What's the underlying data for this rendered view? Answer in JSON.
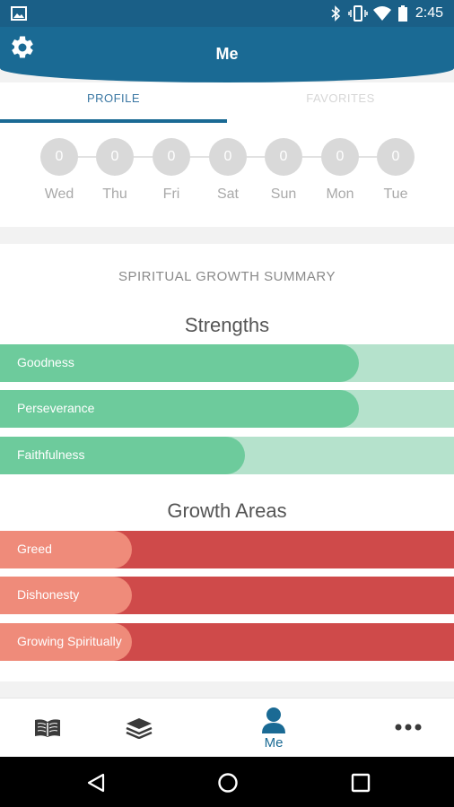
{
  "status_bar": {
    "time": "2:45"
  },
  "app_bar": {
    "title": "Me",
    "settings_icon": "gear-icon"
  },
  "tabs": [
    {
      "label": "PROFILE",
      "active": true
    },
    {
      "label": "FAVORITES",
      "active": false
    }
  ],
  "week": [
    {
      "day": "Wed",
      "count": "0"
    },
    {
      "day": "Thu",
      "count": "0"
    },
    {
      "day": "Fri",
      "count": "0"
    },
    {
      "day": "Sat",
      "count": "0"
    },
    {
      "day": "Sun",
      "count": "0"
    },
    {
      "day": "Mon",
      "count": "0"
    },
    {
      "day": "Tue",
      "count": "0"
    }
  ],
  "summary": {
    "heading": "SPIRITUAL GROWTH SUMMARY",
    "strengths_title": "Strengths",
    "strengths": [
      {
        "label": "Goodness",
        "level": 0.79
      },
      {
        "label": "Perseverance",
        "level": 0.79
      },
      {
        "label": "Faithfulness",
        "level": 0.54
      }
    ],
    "growth_title": "Growth Areas",
    "growth_areas": [
      {
        "label": "Greed",
        "level": 0.29
      },
      {
        "label": "Dishonesty",
        "level": 0.29
      },
      {
        "label": "Growing Spiritually",
        "level": 0.29
      }
    ]
  },
  "bottom_nav": [
    {
      "icon": "book-icon",
      "label": ""
    },
    {
      "icon": "layers-icon",
      "label": ""
    },
    {
      "icon": "person-icon",
      "label": "Me",
      "active": true
    },
    {
      "icon": "more-icon",
      "label": ""
    }
  ],
  "colors": {
    "primary": "#1a6a94",
    "strength": "#6dcb9c",
    "strength_track": "#b5e2cc",
    "growth": "#ef8b7a",
    "growth_track": "#cf4a4a"
  }
}
